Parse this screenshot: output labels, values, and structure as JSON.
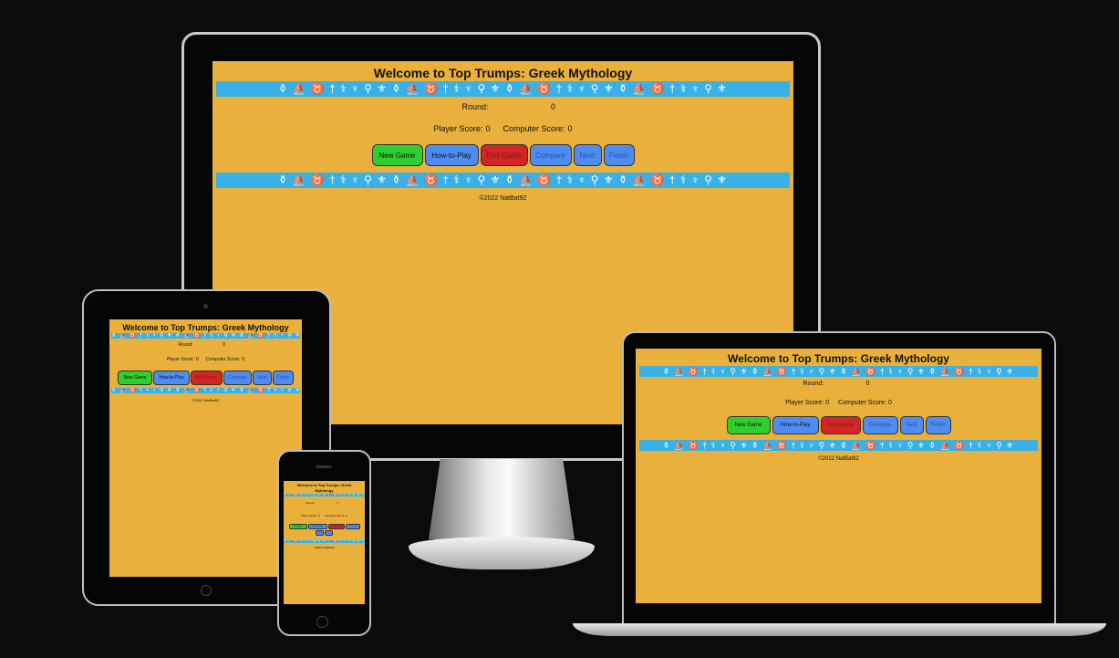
{
  "app": {
    "title": "Welcome to Top Trumps: Greek Mythology",
    "round_label": "Round:",
    "round_value": "0",
    "player_score_label": "Player Score:",
    "player_score_value": "0",
    "computer_score_label": "Computer Score:",
    "computer_score_value": "0",
    "buttons": {
      "new_game": "New Game",
      "how_to_play": "How-to-Play",
      "end_game": "End Game",
      "compare": "Compare",
      "next": "Next",
      "finish": "Finish"
    },
    "footer": "©2022 NatBat92",
    "band_pattern": "⚱ ⛵ ♉ † ⚕ ♆ ⚲ ⚜ ⚱ ⛵ ♉ † ⚕ ♆ ⚲ ⚜ ⚱ ⛵ ♉ † ⚕ ♆ ⚲ ⚜ ⚱ ⛵ ♉ † ⚕ ♆ ⚲ ⚜"
  },
  "colors": {
    "page_bg": "#e9b13c",
    "band": "#39b1e6",
    "new_game": "#2fcf2f",
    "how_to_play": "#4f8cf2",
    "end_game": "#d22525"
  }
}
